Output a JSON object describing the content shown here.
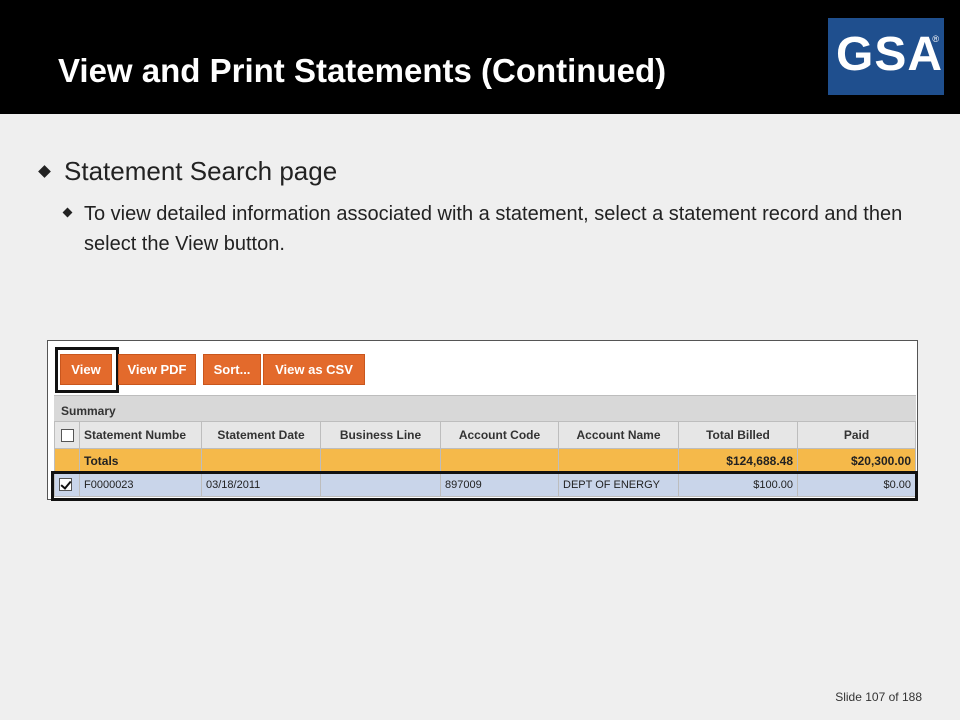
{
  "slide": {
    "title": "View and Print Statements (Continued)",
    "logo_text": "GSA",
    "logo_reg": "®",
    "colors": {
      "header_bg": "#000000",
      "logo_bg": "#1f4f8e",
      "button": "#e36a2c",
      "totals_row": "#f5b94a",
      "selected_row": "#c9d5ea"
    }
  },
  "bullets": {
    "level1": "Statement Search page",
    "level2": "To view detailed information associated with a statement, select a statement record and then select the View button."
  },
  "toolbar": {
    "view_label": "View",
    "view_pdf_label": "View PDF",
    "sort_label": "Sort...",
    "view_csv_label": "View as CSV"
  },
  "summary": {
    "label": "Summary",
    "columns": [
      "Statement Numbe",
      "Statement Date",
      "Business Line",
      "Account Code",
      "Account Name",
      "Total Billed",
      "Paid"
    ],
    "totals": {
      "label": "Totals",
      "total_billed": "$124,688.48",
      "paid": "$20,300.00"
    },
    "row": {
      "checked": true,
      "statement_number": "F0000023",
      "statement_date": "03/18/2011",
      "business_line": "",
      "account_code": "897009",
      "account_name": "DEPT OF ENERGY",
      "total_billed": "$100.00",
      "paid": "$0.00"
    }
  },
  "footer": {
    "slide_word": "Slide",
    "current": "107",
    "of_word": "of",
    "total": "188"
  }
}
